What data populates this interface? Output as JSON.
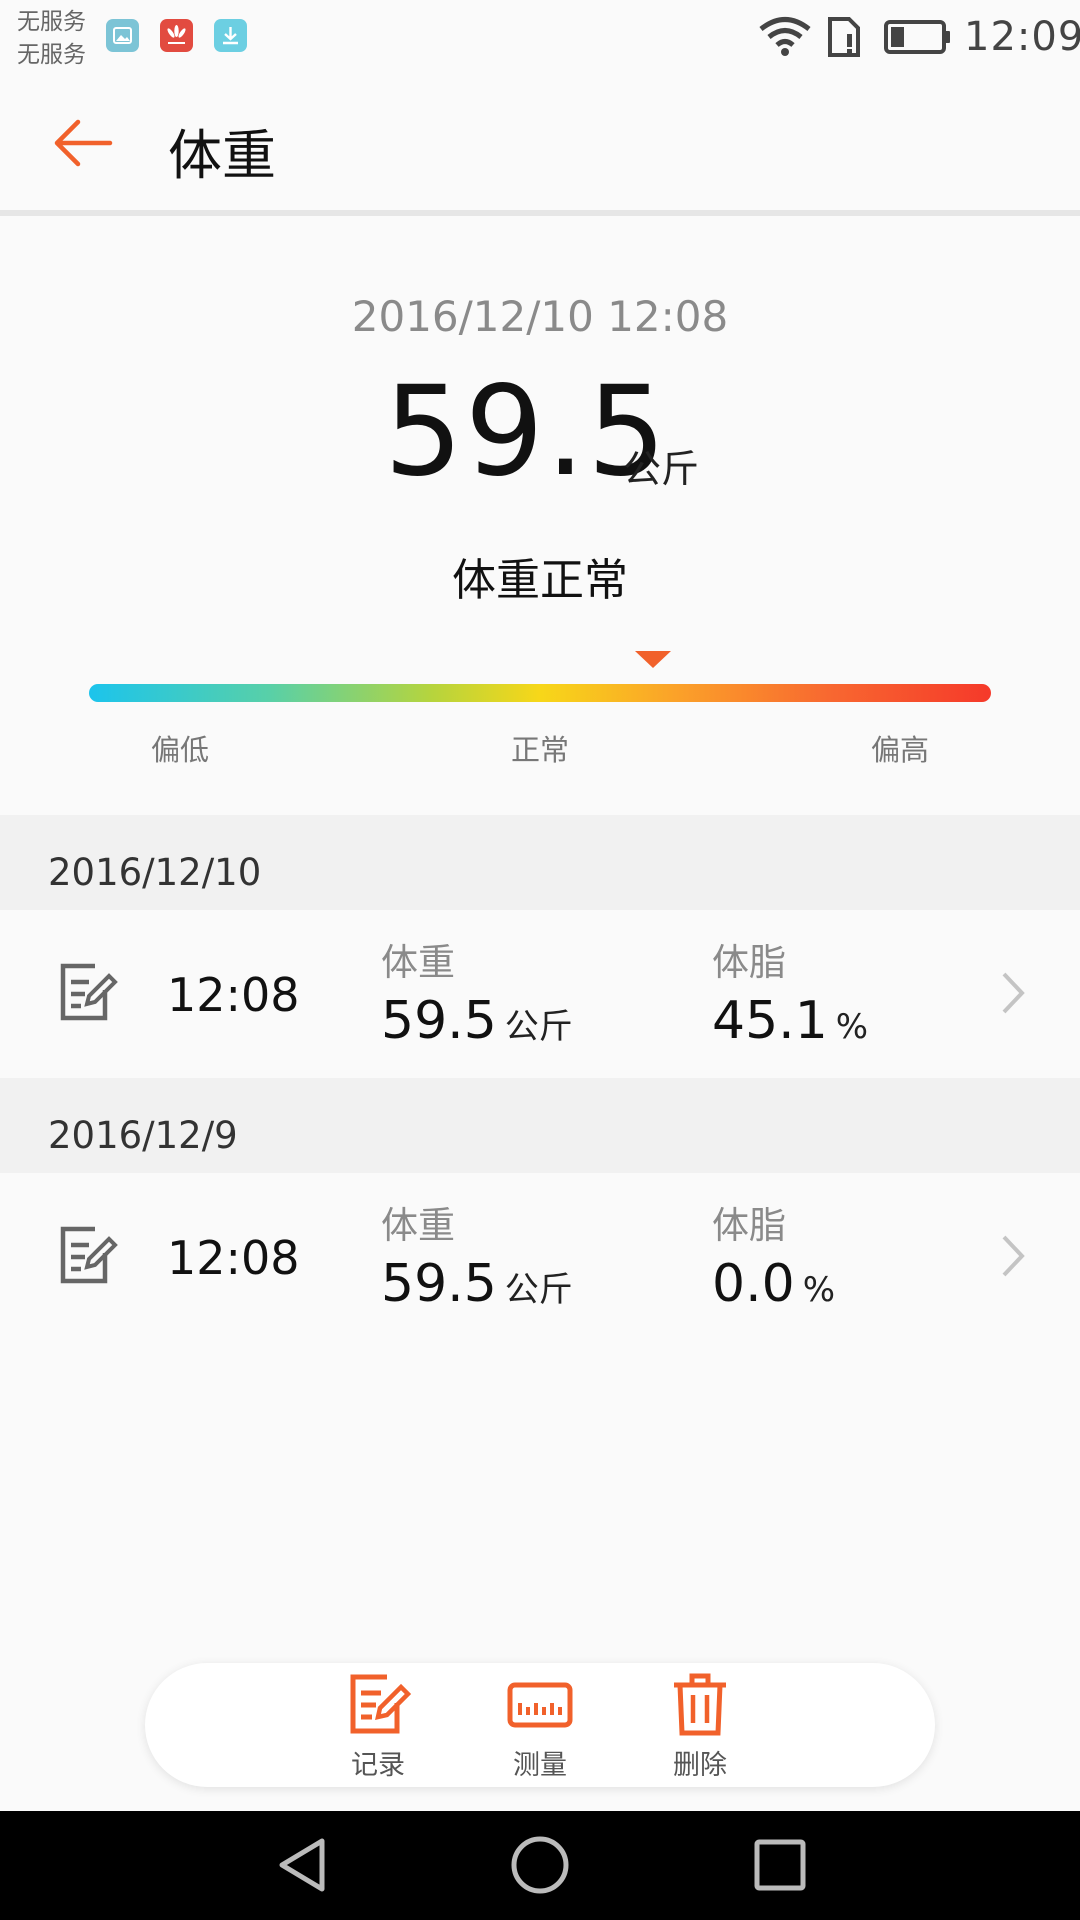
{
  "status_bar": {
    "carrier_line1": "无服务",
    "carrier_line2": "无服务",
    "time": "12:09",
    "icons": [
      "gallery-icon",
      "huawei-icon",
      "download-icon",
      "wifi-icon",
      "sim-icon",
      "battery-icon"
    ]
  },
  "header": {
    "title": "体重",
    "back_icon": "arrow-left-icon",
    "accent_color": "#f1612b"
  },
  "summary": {
    "datetime": "2016/12/10 12:08",
    "weight": "59.5",
    "unit": "公斤",
    "status": "体重正常",
    "scale_labels": [
      "偏低",
      "正常",
      "偏高"
    ]
  },
  "records": [
    {
      "date": "2016/12/10",
      "time": "12:08",
      "weight_label": "体重",
      "weight_value": "59.5",
      "weight_unit": "公斤",
      "fat_label": "体脂",
      "fat_value": "45.1",
      "fat_unit": "%"
    },
    {
      "date": "2016/12/9",
      "time": "12:08",
      "weight_label": "体重",
      "weight_value": "59.5",
      "weight_unit": "公斤",
      "fat_label": "体脂",
      "fat_value": "0.0",
      "fat_unit": "%"
    }
  ],
  "actions": {
    "record_label": "记录",
    "measure_label": "测量",
    "delete_label": "删除"
  }
}
